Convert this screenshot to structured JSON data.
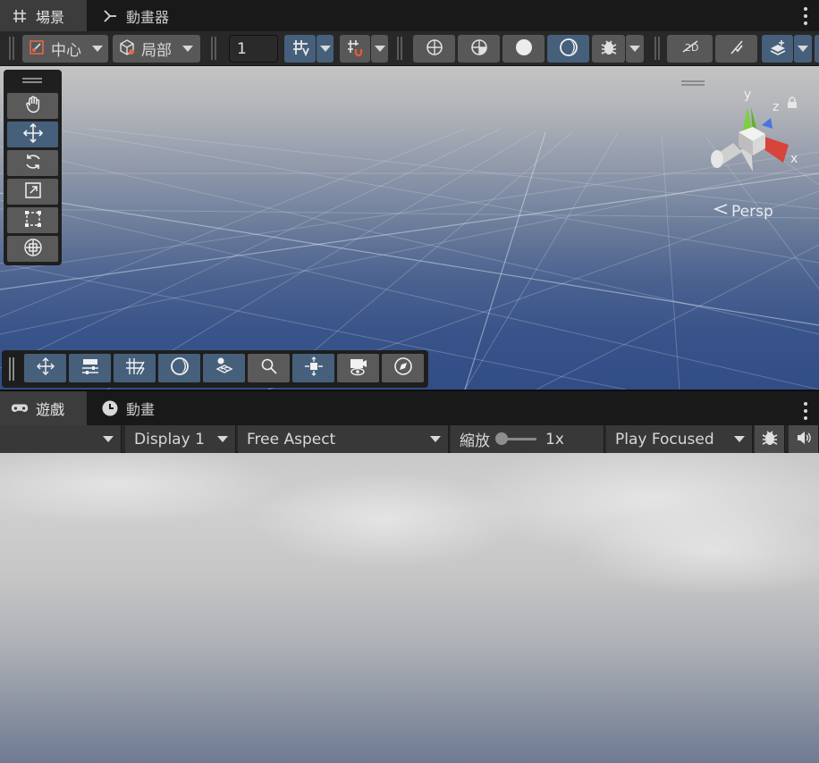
{
  "scene_tabs": [
    {
      "label": "場景",
      "icon": "grid-icon",
      "active": true
    },
    {
      "label": "動畫器",
      "icon": "animator-icon",
      "active": false
    }
  ],
  "scene_toolbar": {
    "pivot_label": "中心",
    "space_label": "局部",
    "grid_size_value": "1"
  },
  "scene_view": {
    "camera_mode": "Persp",
    "gizmo_axes": {
      "y": "y",
      "z": "z",
      "x": "x"
    }
  },
  "game_tabs": [
    {
      "label": "遊戲",
      "icon": "gamepad-icon",
      "active": true
    },
    {
      "label": "動畫",
      "icon": "clock-icon",
      "active": false
    }
  ],
  "game_toolbar": {
    "display_label": "Display 1",
    "aspect_label": "Free Aspect",
    "zoom_label": "縮放",
    "zoom_value": "1x",
    "zoom_level": 0,
    "play_mode_label": "Play Focused"
  },
  "colors": {
    "active_button": "#46607c",
    "button": "#585858",
    "tabbar_bg": "#191919",
    "toolbar_bg": "#282828"
  }
}
